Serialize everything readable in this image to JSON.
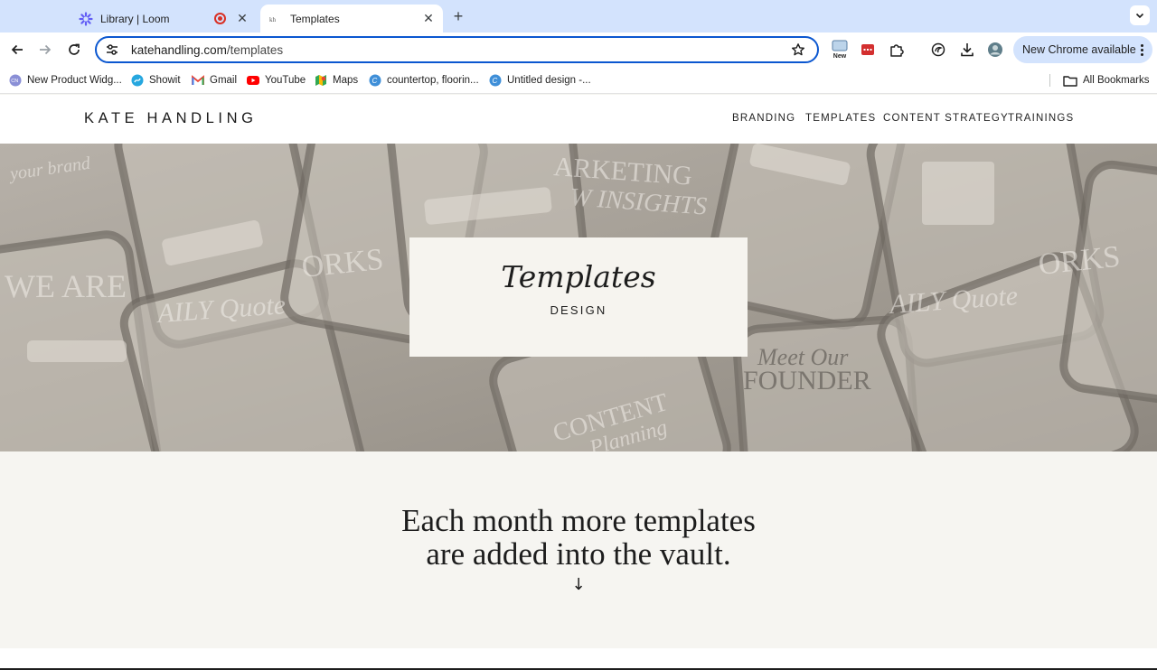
{
  "browser": {
    "tabs": [
      {
        "title": "Library | Loom",
        "icon": "loom-icon"
      },
      {
        "title": "Templates",
        "icon": "kh-favicon"
      }
    ],
    "url_host": "katehandling.com",
    "url_path": "/templates",
    "extension_badge": "New",
    "update_button": "New Chrome available",
    "bookmarks": [
      {
        "label": "New Product Widg...",
        "icon": "cn-icon"
      },
      {
        "label": "Showit",
        "icon": "showit-icon"
      },
      {
        "label": "Gmail",
        "icon": "gmail-icon"
      },
      {
        "label": "YouTube",
        "icon": "youtube-icon"
      },
      {
        "label": "Maps",
        "icon": "maps-icon"
      },
      {
        "label": "countertop, floorin...",
        "icon": "canva-icon"
      },
      {
        "label": "Untitled design -...",
        "icon": "canva-icon"
      }
    ],
    "all_bookmarks": "All Bookmarks",
    "colors": {
      "tabstrip": "#d3e3fd",
      "focus": "#0b57d0"
    }
  },
  "site": {
    "logo": "KATE HANDLING",
    "nav": [
      "BRANDING",
      "TEMPLATES",
      "CONTENT STRATEGY",
      "TRAININGS"
    ],
    "hero": {
      "title": "Templates",
      "subtitle": "DESIGN",
      "background_texts": [
        "your brand",
        "ARKETING",
        "W INSIGHTS",
        "WE ARE",
        "AILY Quote",
        "ORKS",
        "Meet Our",
        "FOUNDER",
        "CONTENT",
        "Planning"
      ]
    },
    "vault": {
      "line1": "Each month more templates",
      "line2": "are added into the vault.",
      "arrow": "↓"
    },
    "colors": {
      "hero_card": "#f6f4ef",
      "section_bg": "#f6f5f1",
      "text": "#1d1d1d"
    }
  }
}
